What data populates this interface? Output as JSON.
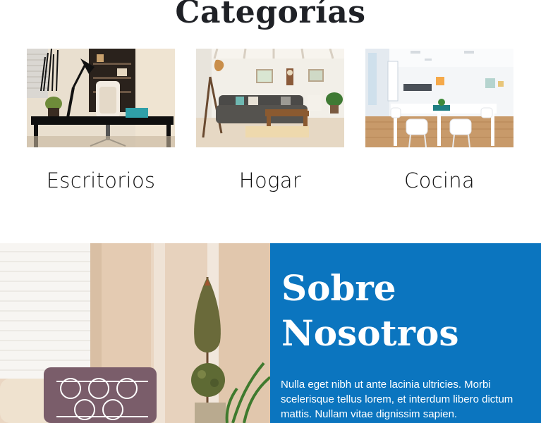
{
  "page": {
    "title": "Categorías"
  },
  "categories": [
    {
      "label": "Escritorios",
      "image": "office-desk-photo"
    },
    {
      "label": "Hogar",
      "image": "living-room-photo"
    },
    {
      "label": "Cocina",
      "image": "white-dining-room-photo"
    }
  ],
  "about": {
    "title_line1": "Sobre",
    "title_line2": "Nosotros",
    "text": "Nulla eget nibh ut ante lacinia ultricies. Morbi scelerisque tellus lorem, et interdum libero dictum mattis. Nullam vitae dignissim sapien.",
    "image": "living-room-plant-photo"
  },
  "colors": {
    "about_background": "#0b75bf",
    "heading_text": "#1f2126"
  }
}
